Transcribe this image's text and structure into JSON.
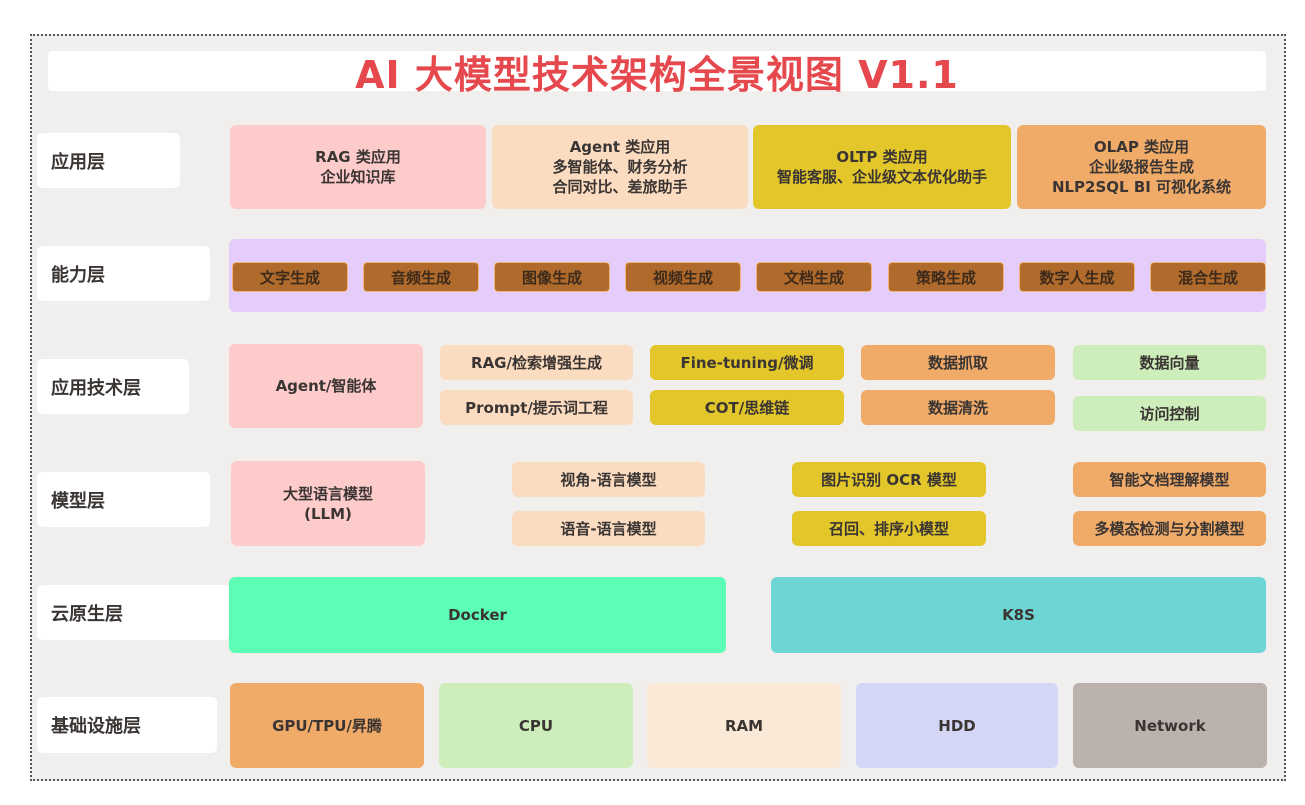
{
  "title": "AI 大模型技术架构全景视图 V1.1",
  "layers": {
    "application": {
      "label": "应用层",
      "items": [
        {
          "lines": [
            "RAG 类应用",
            "企业知识库"
          ],
          "color": "#fecbcb"
        },
        {
          "lines": [
            "Agent 类应用",
            "多智能体、财务分析",
            "合同对比、差旅助手"
          ],
          "color": "#fbdcc0"
        },
        {
          "lines": [
            "OLTP 类应用",
            "智能客服、企业级文本优化助手"
          ],
          "color": "#e2c62a"
        },
        {
          "lines": [
            "OLAP 类应用",
            "企业级报告生成",
            "NLP2SQL BI 可视化系统"
          ],
          "color": "#f0ab69"
        }
      ]
    },
    "capability": {
      "label": "能力层",
      "background": "#e4cdfb",
      "chip_color": "#b06a2b",
      "items": [
        "文字生成",
        "音频生成",
        "图像生成",
        "视频生成",
        "文档生成",
        "策略生成",
        "数字人生成",
        "混合生成"
      ]
    },
    "app_tech": {
      "label": "应用技术层",
      "agent": "Agent/智能体",
      "col1": [
        "RAG/检索增强生成",
        "Prompt/提示词工程"
      ],
      "col2": [
        "Fine-tuning/微调",
        "COT/思维链"
      ],
      "col3": [
        "数据抓取",
        "数据清洗"
      ],
      "col4": [
        "数据向量",
        "访问控制"
      ]
    },
    "model": {
      "label": "模型层",
      "llm": [
        "大型语言模型",
        "(LLM)"
      ],
      "col1": [
        "视角-语言模型",
        "语音-语言模型"
      ],
      "col2": [
        "图片识别 OCR 模型",
        "召回、排序小模型"
      ],
      "col3": [
        "智能文档理解模型",
        "多模态检测与分割模型"
      ]
    },
    "cloud_native": {
      "label": "云原生层",
      "items": [
        "Docker",
        "K8S"
      ]
    },
    "infrastructure": {
      "label": "基础设施层",
      "items": [
        "GPU/TPU/昇腾",
        "CPU",
        "RAM",
        "HDD",
        "Network"
      ]
    }
  },
  "colors": {
    "title": "#e5484d",
    "frame_bg": "#f1efee"
  }
}
